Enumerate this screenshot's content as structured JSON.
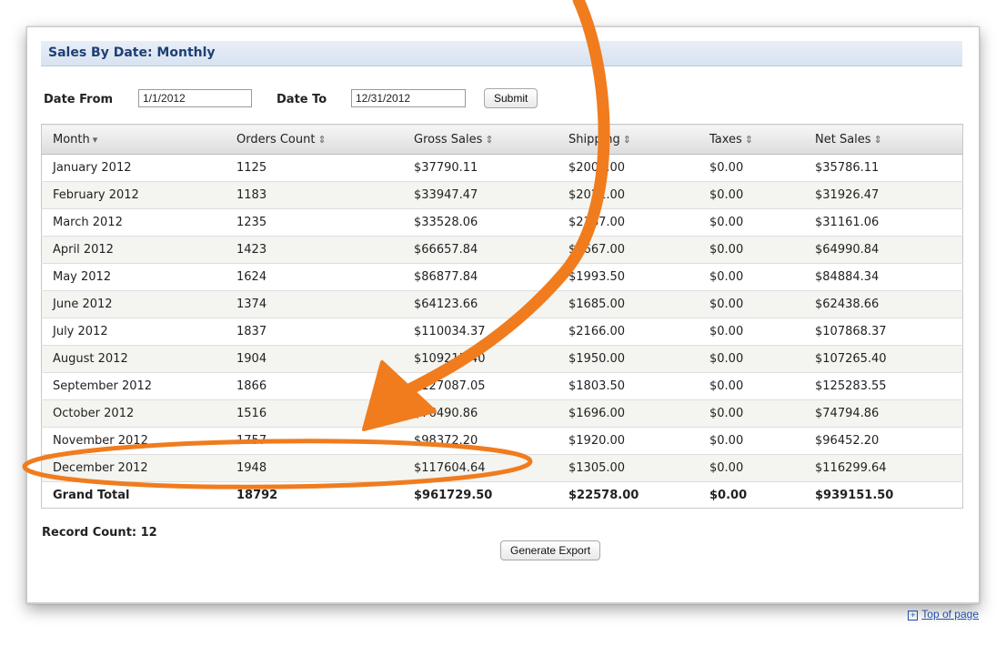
{
  "panel": {
    "title": "Sales By Date: Monthly"
  },
  "filter": {
    "date_from_label": "Date From",
    "date_from_value": "1/1/2012",
    "date_to_label": "Date To",
    "date_to_value": "12/31/2012",
    "submit_label": "Submit"
  },
  "table": {
    "headers": [
      "Month",
      "Orders Count",
      "Gross Sales",
      "Shipping",
      "Taxes",
      "Net Sales"
    ],
    "sort_icons": [
      "▾",
      "⇕",
      "⇕",
      "⇕",
      "⇕",
      "⇕"
    ],
    "rows": [
      [
        "January 2012",
        "1125",
        "$37790.11",
        "$2004.00",
        "$0.00",
        "$35786.11"
      ],
      [
        "February 2012",
        "1183",
        "$33947.47",
        "$2021.00",
        "$0.00",
        "$31926.47"
      ],
      [
        "March 2012",
        "1235",
        "$33528.06",
        "$2367.00",
        "$0.00",
        "$31161.06"
      ],
      [
        "April 2012",
        "1423",
        "$66657.84",
        "$1667.00",
        "$0.00",
        "$64990.84"
      ],
      [
        "May 2012",
        "1624",
        "$86877.84",
        "$1993.50",
        "$0.00",
        "$84884.34"
      ],
      [
        "June 2012",
        "1374",
        "$64123.66",
        "$1685.00",
        "$0.00",
        "$62438.66"
      ],
      [
        "July 2012",
        "1837",
        "$110034.37",
        "$2166.00",
        "$0.00",
        "$107868.37"
      ],
      [
        "August 2012",
        "1904",
        "$109215.40",
        "$1950.00",
        "$0.00",
        "$107265.40"
      ],
      [
        "September 2012",
        "1866",
        "$127087.05",
        "$1803.50",
        "$0.00",
        "$125283.55"
      ],
      [
        "October 2012",
        "1516",
        "$76490.86",
        "$1696.00",
        "$0.00",
        "$74794.86"
      ],
      [
        "November 2012",
        "1757",
        "$98372.20",
        "$1920.00",
        "$0.00",
        "$96452.20"
      ],
      [
        "December 2012",
        "1948",
        "$117604.64",
        "$1305.00",
        "$0.00",
        "$116299.64"
      ]
    ],
    "total": [
      "Grand Total",
      "18792",
      "$961729.50",
      "$22578.00",
      "$0.00",
      "$939151.50"
    ]
  },
  "summary": {
    "record_count": "Record Count: 12",
    "export_label": "Generate Export"
  },
  "footer": {
    "top_link": "Top of page"
  },
  "colors": {
    "annotation": "#f07c1e",
    "title": "#1d3f73",
    "link": "#1f4fa8"
  }
}
